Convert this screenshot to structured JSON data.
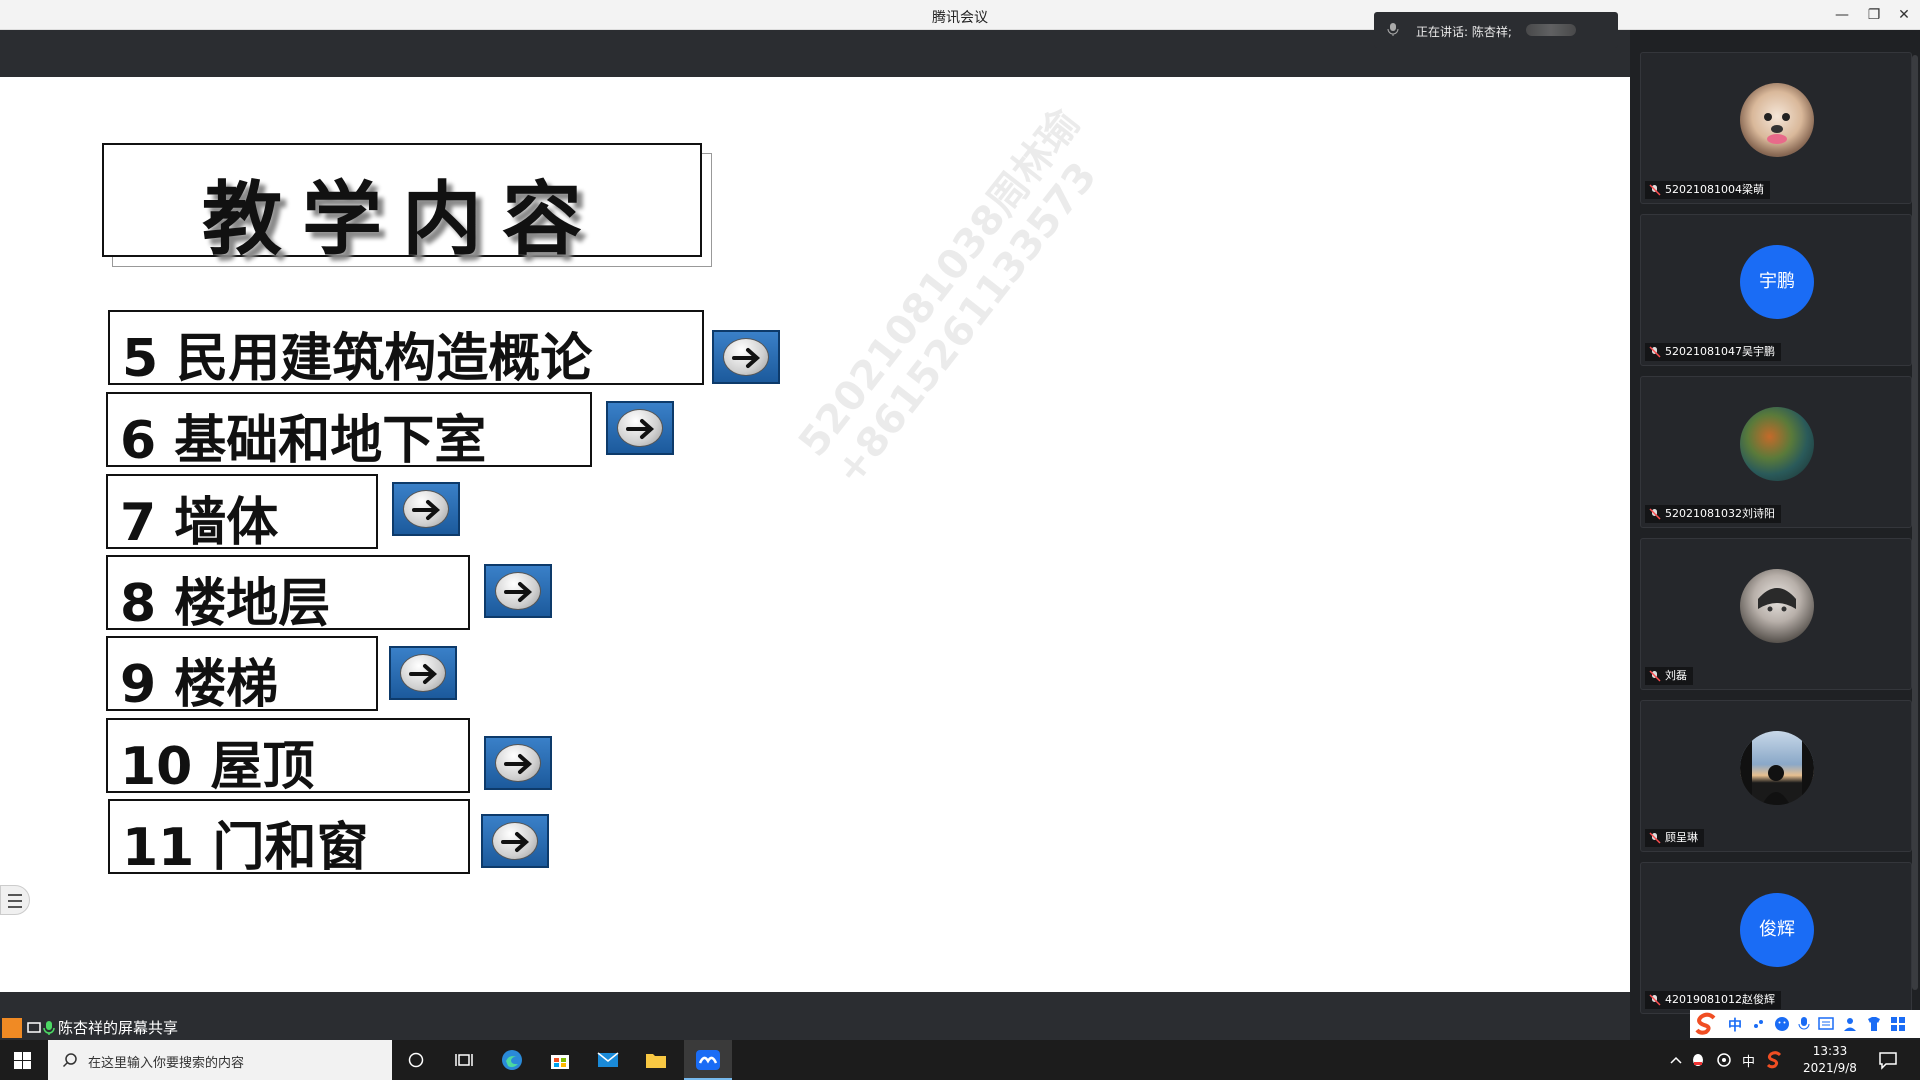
{
  "window": {
    "title": "腾讯会议",
    "minimize": "—",
    "restore": "❐",
    "close": "✕"
  },
  "speaking": {
    "label": "正在讲话: 陈杏祥;"
  },
  "slide": {
    "title": "教学内容",
    "items": [
      {
        "text": "5  民用建筑构造概论"
      },
      {
        "text": "6  基础和地下室"
      },
      {
        "text": "7  墙体"
      },
      {
        "text": "8  楼地层"
      },
      {
        "text": "9  楼梯"
      },
      {
        "text": "10  屋顶"
      },
      {
        "text": "11  门和窗"
      }
    ],
    "watermark_line1": "52021081038周林瑜",
    "watermark_line2": "+8615261133573"
  },
  "share": {
    "label": "陈杏祥的屏幕共享"
  },
  "participants": [
    {
      "name": "52021081004梁萌",
      "avatar_type": "photo-dog"
    },
    {
      "name": "52021081047吴宇鹏",
      "avatar_type": "text",
      "avatar_text": "宇鹏"
    },
    {
      "name": "52021081032刘诗阳",
      "avatar_type": "photo-abstract"
    },
    {
      "name": "刘磊",
      "avatar_type": "photo-anime"
    },
    {
      "name": "顾呈琳",
      "avatar_type": "photo-window"
    },
    {
      "name": "42019081012赵俊辉",
      "avatar_type": "text",
      "avatar_text": "俊辉"
    }
  ],
  "taskbar": {
    "search_placeholder": "在这里输入你要搜索的内容",
    "time": "13:33",
    "date": "2021/9/8",
    "ime_lang": "中"
  }
}
